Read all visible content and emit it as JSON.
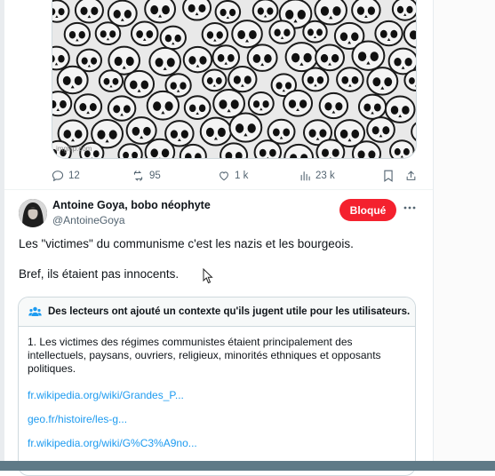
{
  "media": {
    "watermark": "imgflip.com"
  },
  "actions": {
    "replies": "12",
    "reposts": "95",
    "likes": "1 k",
    "views": "23 k"
  },
  "post": {
    "author_name": "Antoine Goya, bobo néophyte",
    "author_handle": "@AntoineGoya",
    "blocked_label": "Bloqué",
    "text_lines": [
      "Les \"victimes\" du communisme c'est les nazis et les bourgeois.",
      "Bref, ils étaient pas innocents."
    ]
  },
  "community_note": {
    "title": "Des lecteurs ont ajouté un contexte qu'ils jugent utile pour les utilisateurs.",
    "body": "1. Les victimes des régimes communistes étaient principalement des intellectuels, paysans, ouvriers, religieux, minorités ethniques et opposants politiques.",
    "links": [
      "fr.wikipedia.org/wiki/Grandes_P...",
      "geo.fr/histoire/les-g...",
      "fr.wikipedia.org/wiki/G%C3%A9no..."
    ]
  },
  "colors": {
    "accent": "#1d9bf0",
    "blocked": "#f4212e",
    "muted": "#536471"
  }
}
